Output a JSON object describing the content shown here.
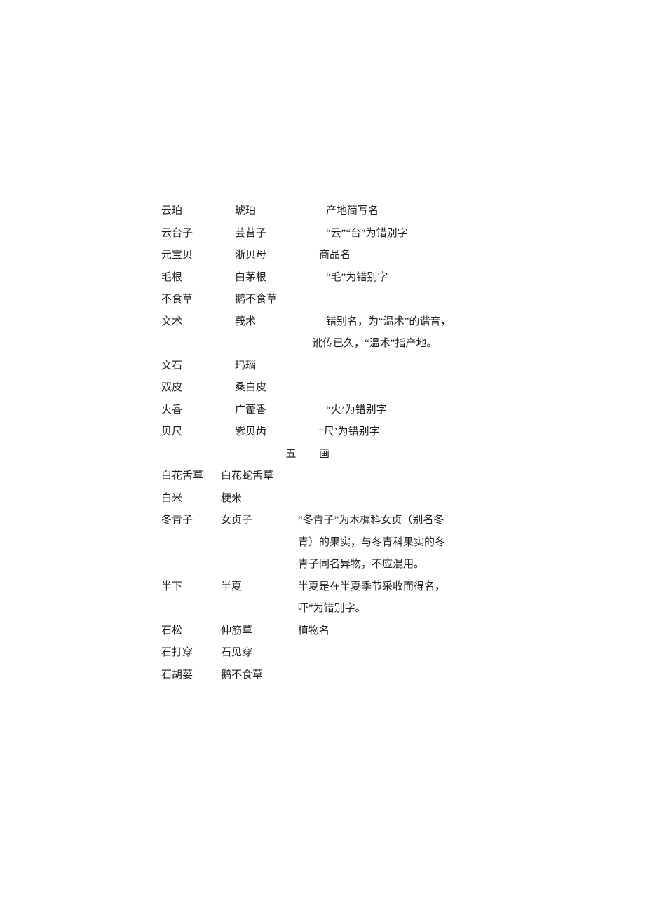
{
  "rows": [
    {
      "c1": "云珀",
      "c2": "琥珀",
      "c3": "产地简写名"
    },
    {
      "c1": "云台子",
      "c2": "芸苔子",
      "c3": "“云”“台”为错别字"
    },
    {
      "c1": "元宝贝",
      "c2": "浙贝母",
      "c3": "商品名"
    },
    {
      "c1": "毛根",
      "c2": "白茅根",
      "c3": "“毛”为错别字"
    },
    {
      "c1": "不食草",
      "c2": "鹅不食草",
      "c3": ""
    },
    {
      "c1": "文术",
      "c2": "莪术",
      "c3": "错别名，为“温术”的谐音，",
      "cont": [
        "讹传已久，“温术”指产地。"
      ]
    },
    {
      "c1": "文石",
      "c2": "玛瑙",
      "c3": ""
    },
    {
      "c1": "双皮",
      "c2": "桑白皮",
      "c3": ""
    },
    {
      "c1": "火香",
      "c2": "广藿香",
      "c3": "“火’为错别字"
    },
    {
      "c1": "贝尺",
      "c2": "紫贝齿",
      "c3": "“尺’为错别字"
    }
  ],
  "section": {
    "a": "五",
    "b": "画"
  },
  "rows2": [
    {
      "c1": "白花舌草",
      "c2": "白花蛇舌草",
      "c3": ""
    },
    {
      "c1": "白米",
      "c2": "粳米",
      "c3": ""
    },
    {
      "c1": "冬青子",
      "c2": "女贞子",
      "c3": "“冬青子”为木樨科女贞（别名冬",
      "cont": [
        "青）的果实，与冬青科果实的冬",
        "青子同名异物，不应混用。"
      ]
    },
    {
      "c1": "半下",
      "c2": "半夏",
      "c3": "半夏是在半夏季节采收而得名，",
      "cont": [
        "吓”为错别字。"
      ]
    },
    {
      "c1": "石松",
      "c2": "伸筋草",
      "c3": "植物名"
    },
    {
      "c1": "石打穿",
      "c2": "石见穿",
      "c3": ""
    },
    {
      "c1": "石胡荽",
      "c2": "鹅不食草",
      "c3": ""
    }
  ]
}
